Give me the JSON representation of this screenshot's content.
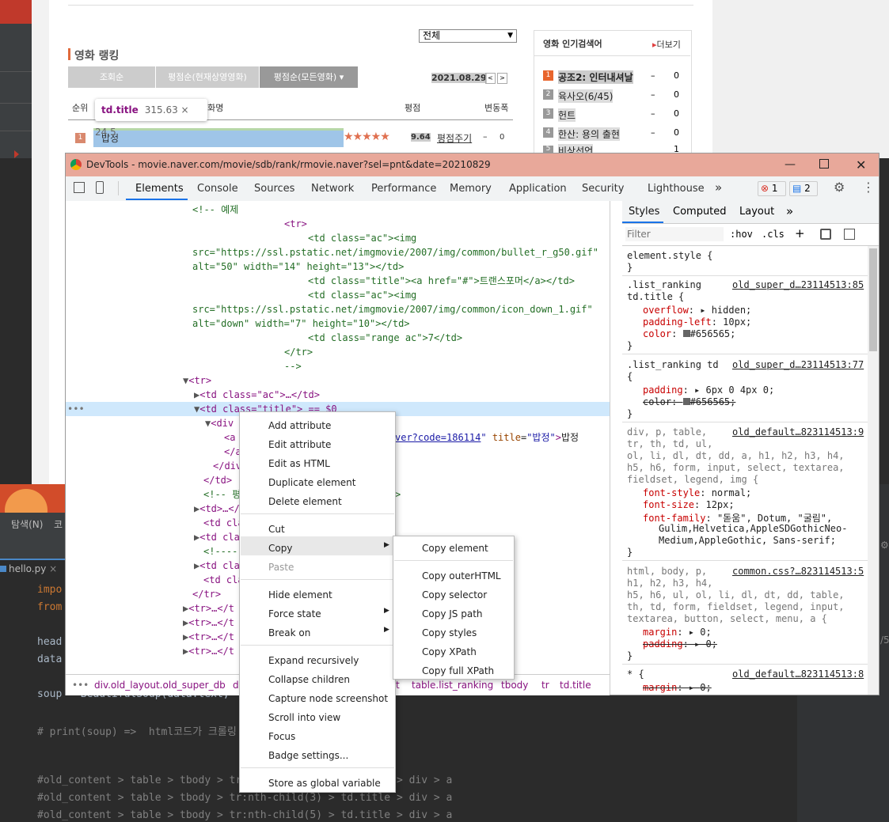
{
  "naver": {
    "select_value": "전체",
    "section_title": "영화 랭킹",
    "tabs": [
      "조회순",
      "평점순(현재상영영화)",
      "평점순(모든영화)"
    ],
    "date": "2021.08.29",
    "col_rank": "순위",
    "col_title": "영화명",
    "col_score": "평점",
    "col_change": "변동폭",
    "row1": {
      "rank": "1",
      "title": "밥정",
      "score": "9.64",
      "rate": "평점주기",
      "change": "0"
    },
    "side_title": "영화 인기검색어",
    "side_more": "더보기",
    "side_items": [
      {
        "rank": "1",
        "title": "공조2: 인터내셔날",
        "change": "0"
      },
      {
        "rank": "2",
        "title": "육사오(6/45)",
        "change": "0"
      },
      {
        "rank": "3",
        "title": "헌트",
        "change": "0"
      },
      {
        "rank": "4",
        "title": "한산: 용의 출현",
        "change": "0"
      },
      {
        "rank": "5",
        "title": "비상선언",
        "change": "1"
      }
    ],
    "tooltip_tag": "td.title",
    "tooltip_size": "315.63 × 24.5"
  },
  "devtools": {
    "title": "DevTools - movie.naver.com/movie/sdb/rank/rmovie.naver?sel=pnt&date=20210829",
    "tabs": [
      "Elements",
      "Console",
      "Sources",
      "Network",
      "Performance",
      "Memory",
      "Application",
      "Security",
      "Lighthouse"
    ],
    "error_count": "1",
    "message_count": "2",
    "code": {
      "l1": "<!-- 예제",
      "l2": "<tr>",
      "l3": "<td class=\"ac\"><img",
      "l4": "src=\"https://ssl.pstatic.net/imgmovie/2007/img/common/bullet_r_g50.gif\"",
      "l5": "alt=\"50\" width=\"14\" height=\"13\"></td>",
      "l6": "<td class=\"title\"><a href=\"#\">트랜스포머</a></td>",
      "l7": "<td class=\"ac\"><img",
      "l8": "src=\"https://ssl.pstatic.net/imgmovie/2007/img/common/icon_down_1.gif\"",
      "l9": "alt=\"down\" width=\"7\" height=\"10\"></td>",
      "l10": "<td class=\"range ac\">7</td>",
      "l11": "</tr>",
      "l12": "-->",
      "l13": "<tr>",
      "l14": "<td class=\"ac\">…</td>",
      "l15": "<td class=\"title\"> == $0",
      "l16": "<div",
      "l17a": "<a",
      "l17b": "ver?code=186114\" title=\"밥정\">밥정",
      "l18": "</a",
      "l19": "</div",
      "l20": "</td>",
      "l21a": "<!-- 평",
      "l21b": ">",
      "l22": "<td>…</",
      "l23": "<td cla",
      "l24": "<td cla",
      "l25": "<!----",
      "l26": "<td cla",
      "l27": "<td cla",
      "l28": "</tr>",
      "l29": "<tr>…</t",
      "l30": "<tr>…</t",
      "l31": "<tr>…</t",
      "l32": "<tr>…</t"
    },
    "breadcrumb": [
      "div.old_layout.old_super_db",
      "d",
      "t",
      "table.list_ranking",
      "tbody",
      "tr",
      "td.title"
    ],
    "styles_tabs": [
      "Styles",
      "Computed",
      "Layout"
    ],
    "filter_placeholder": "Filter",
    "hov": ":hov",
    "cls": ".cls",
    "styles": {
      "s1": "element.style {",
      "s1e": "}",
      "s2sel": ".list_ranking",
      "s2sel2": "td.title {",
      "s2src": "old_super_d…23114513:85",
      "s2p1": "overflow",
      "s2v1": "hidden;",
      "s2p2": "padding-left",
      "s2v2": "10px;",
      "s2p3": "color",
      "s2v3": "#656565;",
      "s3sel": ".list_ranking td",
      "s3src": "old_super_d…23114513:77",
      "s3p1": "padding",
      "s3v1": "6px 0 4px 0;",
      "s3p2": "color",
      "s3v2": "#656565;",
      "s4l1": "div, p, table,",
      "s4src": "old_default…823114513:9",
      "s4l2": "tr, th, td, ul,",
      "s4l3": "ol, li, dl, dt, dd, a, h1, h2, h3, h4,",
      "s4l4": "h5, h6, form, input, select, textarea,",
      "s4l5": "fieldset, legend, img {",
      "s4p1": "font-style",
      "s4v1": "normal;",
      "s4p2": "font-size",
      "s4v2": "12px;",
      "s4p3": "font-family",
      "s4v3": "\"돋움\", Dotum, \"굴림\",",
      "s4v3b": "Gulim,Helvetica,AppleSDGothicNeo-",
      "s4v3c": "Medium,AppleGothic, Sans-serif;",
      "s5l1": "html, body, p,",
      "s5src": "common.css?…823114513:5",
      "s5l2": "h1, h2, h3, h4,",
      "s5l3": "h5, h6, ul, ol, li, dl, dt, dd, table,",
      "s5l4": "th, td, form, fieldset, legend, input,",
      "s5l5": "textarea, button, select, menu, a {",
      "s5p1": "margin",
      "s5v1": "0;",
      "s5p2": "padding",
      "s5v2": "0;",
      "s6sel": "* {",
      "s6src": "old_default…823114513:8",
      "s6p1": "margin",
      "s6v1": "0;"
    }
  },
  "context_menu": {
    "items1": [
      "Add attribute",
      "Edit attribute",
      "Edit as HTML",
      "Duplicate element",
      "Delete element"
    ],
    "items2": [
      "Cut",
      "Copy",
      "Paste"
    ],
    "items3": [
      "Hide element",
      "Force state",
      "Break on"
    ],
    "items4": [
      "Expand recursively",
      "Collapse children",
      "Capture node screenshot",
      "Scroll into view",
      "Focus",
      "Badge settings..."
    ],
    "items5": [
      "Store as global variable"
    ]
  },
  "copy_submenu": {
    "items1": [
      "Copy element"
    ],
    "items2": [
      "Copy outerHTML",
      "Copy selector",
      "Copy JS path",
      "Copy styles",
      "Copy XPath",
      "Copy full XPath"
    ]
  },
  "pycharm": {
    "menu_find": "탐색(N)",
    "menu_code": "코",
    "file_tab": "hello.py",
    "lines": [
      "impo",
      "from",
      "",
      "head",
      "data",
      "",
      "soup = BeautifulSoup(data.text,",
      "",
      "# print(soup) =>  html코드가 크롤링",
      "",
      "",
      "#old_content > table > tbody > tr:nth-child(2) > td.title > div > a",
      "#old_content > table > tbody > tr:nth-child(3) > td.title > div > a",
      "#old_content > table > tbody > tr:nth-child(5) > td.title > div > a"
    ],
    "right_num": "/5"
  }
}
